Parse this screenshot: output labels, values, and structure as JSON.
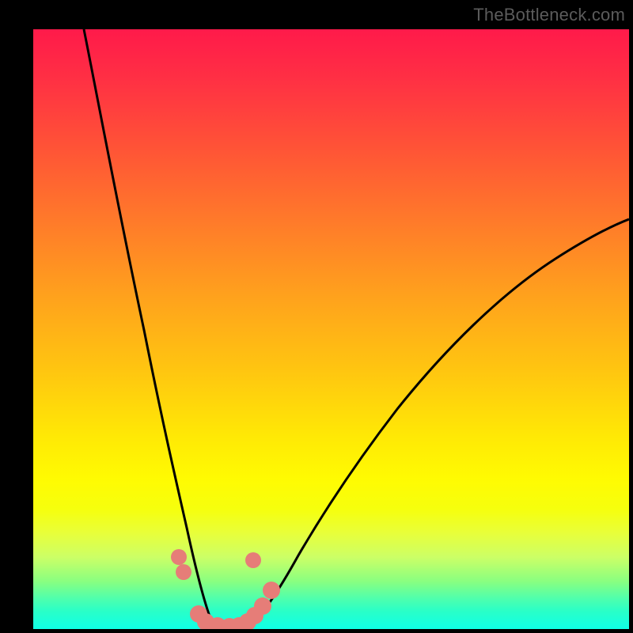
{
  "watermark": {
    "text": "TheBottleneck.com"
  },
  "colors": {
    "frame": "#000000",
    "curve": "#000000",
    "marker_fill": "#e67d78",
    "marker_stroke": "#e67d78",
    "gradient_stops": [
      "#ff1a4a",
      "#ff2f44",
      "#ff5436",
      "#ff7a2a",
      "#ffa31c",
      "#ffc90f",
      "#ffe905",
      "#fffb02",
      "#f6ff0d",
      "#e8ff3a",
      "#ccff66",
      "#8aff80",
      "#4dffae",
      "#2affc7",
      "#18ffdd",
      "#10ffe5"
    ],
    "band_pale": "#ffffb8"
  },
  "chart_data": {
    "type": "line",
    "title": "",
    "xlabel": "",
    "ylabel": "",
    "xlim": [
      0,
      100
    ],
    "ylim": [
      0,
      100
    ],
    "grid": false,
    "legend": false,
    "background": "vertical-gradient red→yellow→green",
    "series": [
      {
        "name": "left-branch",
        "x": [
          8.5,
          10,
          12,
          14,
          16,
          18,
          20,
          22,
          23.8,
          25,
          26,
          27,
          28,
          29,
          30
        ],
        "y": [
          100,
          92,
          80,
          67,
          55,
          44,
          34,
          25,
          18,
          13,
          9,
          6,
          3.5,
          1.5,
          0
        ]
      },
      {
        "name": "right-branch",
        "x": [
          36,
          38,
          40,
          43,
          46,
          50,
          55,
          60,
          66,
          73,
          80,
          88,
          96,
          100
        ],
        "y": [
          0,
          2,
          4.5,
          8,
          12,
          17,
          23,
          29,
          35,
          42,
          49,
          56,
          62,
          65
        ]
      },
      {
        "name": "floor",
        "x": [
          30,
          36
        ],
        "y": [
          0,
          0
        ]
      }
    ],
    "markers": [
      {
        "x": 24.5,
        "y": 12
      },
      {
        "x": 25.3,
        "y": 9.5
      },
      {
        "x": 27.8,
        "y": 2.5
      },
      {
        "x": 29.0,
        "y": 1.2
      },
      {
        "x": 31.0,
        "y": 0.5
      },
      {
        "x": 33.0,
        "y": 0.4
      },
      {
        "x": 34.5,
        "y": 0.6
      },
      {
        "x": 36.0,
        "y": 1.2
      },
      {
        "x": 37.2,
        "y": 2.2
      },
      {
        "x": 38.5,
        "y": 3.8
      },
      {
        "x": 40.0,
        "y": 6.5
      },
      {
        "x": 37.0,
        "y": 11.5
      }
    ]
  }
}
